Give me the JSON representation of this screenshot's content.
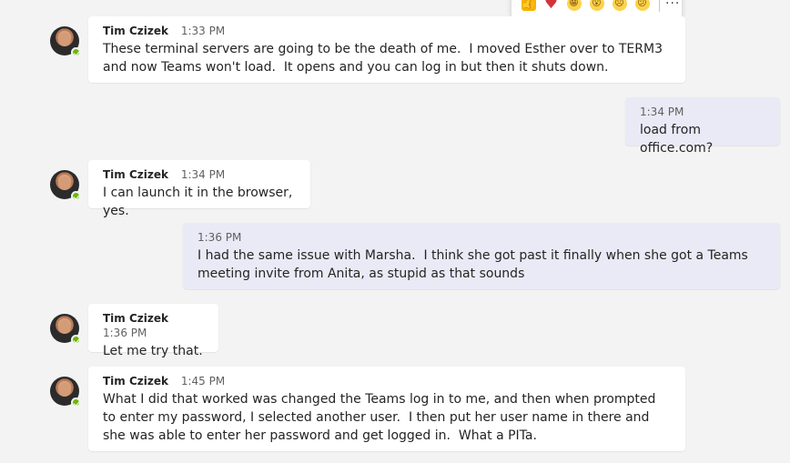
{
  "reactions": {
    "like": "👍",
    "heart": "♥",
    "laugh": "😁",
    "surprised": "😮",
    "sad": "☹",
    "angry": "😕",
    "more": "···"
  },
  "messages": [
    {
      "sender": "Tim Czizek",
      "time": "1:33 PM",
      "text": "These terminal servers are going to be the death of me.  I moved Esther over to TERM3 and now Teams won't load.  It opens and you can log in but then it shuts down."
    },
    {
      "time": "1:34 PM",
      "text": "load from office.com?"
    },
    {
      "sender": "Tim Czizek",
      "time": "1:34 PM",
      "text": "I can launch it in the browser, yes."
    },
    {
      "time": "1:36 PM",
      "text": "I had the same issue with Marsha.  I think she got past it finally when she got a Teams meeting invite from Anita, as stupid as that sounds"
    },
    {
      "sender": "Tim Czizek",
      "time": "1:36 PM",
      "text": "Let me try that."
    },
    {
      "sender": "Tim Czizek",
      "time": "1:45 PM",
      "text": "What I did that worked was changed the Teams log in to me, and then when prompted to enter my password, I selected another user.  I then put her user name in there and she was able to enter her password and get logged in.  What a PITa."
    }
  ]
}
